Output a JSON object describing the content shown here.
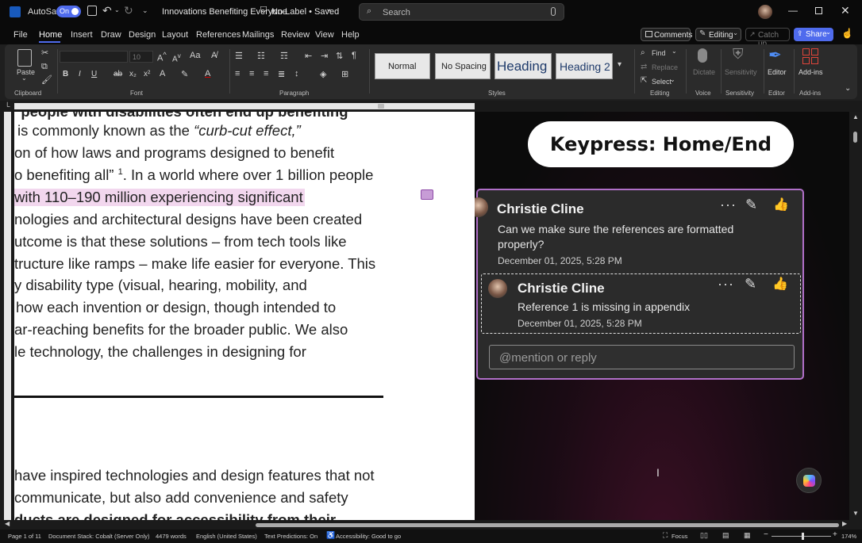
{
  "titlebar": {
    "autosave_label": "AutoSave",
    "autosave_state": "On",
    "doc_title": "Innovations Benefiting Everyone",
    "label_status": "No Label • Saved",
    "search_placeholder": "Search"
  },
  "tabs": [
    "File",
    "Home",
    "Insert",
    "Draw",
    "Design",
    "Layout",
    "References",
    "Mailings",
    "Review",
    "View",
    "Help"
  ],
  "active_tab": "Home",
  "topright": {
    "comments": "Comments",
    "editing": "Editing",
    "catchup": "Catch up",
    "share": "Share"
  },
  "ribbon": {
    "paste": "Paste",
    "font_size": "10",
    "groups": {
      "clipboard": "Clipboard",
      "font": "Font",
      "paragraph": "Paragraph",
      "styles": "Styles",
      "editing": "Editing",
      "voice": "Voice",
      "sensitivity": "Sensitivity",
      "editor": "Editor",
      "addins": "Add-ins"
    },
    "styles": [
      "Normal",
      "No Spacing",
      "Heading 1",
      "Heading 2"
    ],
    "find": "Find",
    "replace": "Replace",
    "select": "Select",
    "dictate": "Dictate",
    "sensitivity": "Sensitivity",
    "editor": "Editor",
    "addins": "Add-ins"
  },
  "document": {
    "lines": [
      "r people with disabilities often end up benefiting",
      "is commonly known as the ",
      "on of how laws and programs designed to benefit",
      "o benefiting all” ",
      "with 110–190 million experiencing significant",
      "nologies and architectural designs have been created",
      "utcome is that these solutions – from tech tools like",
      "tructure like ramps – make life easier for everyone. This",
      "y disability type (visual, hearing, mobility, and",
      "how each invention or design, though intended to",
      "ar-reaching benefits for the broader public. We also",
      "le technology, the challenges in designing for"
    ],
    "italic_phrase": "“curb-cut effect,”",
    "superscript": "1",
    "line4_tail": ". In a world where over 1 billion people",
    "lower_lines": [
      "have inspired technologies and design features that not",
      "communicate, but also add convenience and safety",
      "ducts are designed for accessibility from their"
    ]
  },
  "keypress_banner": "Keypress: Home/End",
  "comments": [
    {
      "author": "Christie Cline",
      "text": "Can we make sure the references are formatted properly?",
      "date": "December 01, 2025, 5:28 PM"
    },
    {
      "author": "Christie Cline",
      "text": "Reference 1 is missing in appendix",
      "date": "December 01, 2025, 5:28 PM"
    }
  ],
  "reply_placeholder": "@mention or reply",
  "status": {
    "page": "Page 1 of 11",
    "doc_stack": "Document Stack: Cobalt (Server Only)",
    "words": "4479 words",
    "language": "English (United States)",
    "predictions": "Text Predictions: On",
    "accessibility": "Accessibility: Good to go",
    "focus": "Focus",
    "zoom": "174%"
  },
  "colors": {
    "accent": "#4f6bed",
    "highlight": "#f2d7ee",
    "thread_border": "#b06fc8"
  }
}
